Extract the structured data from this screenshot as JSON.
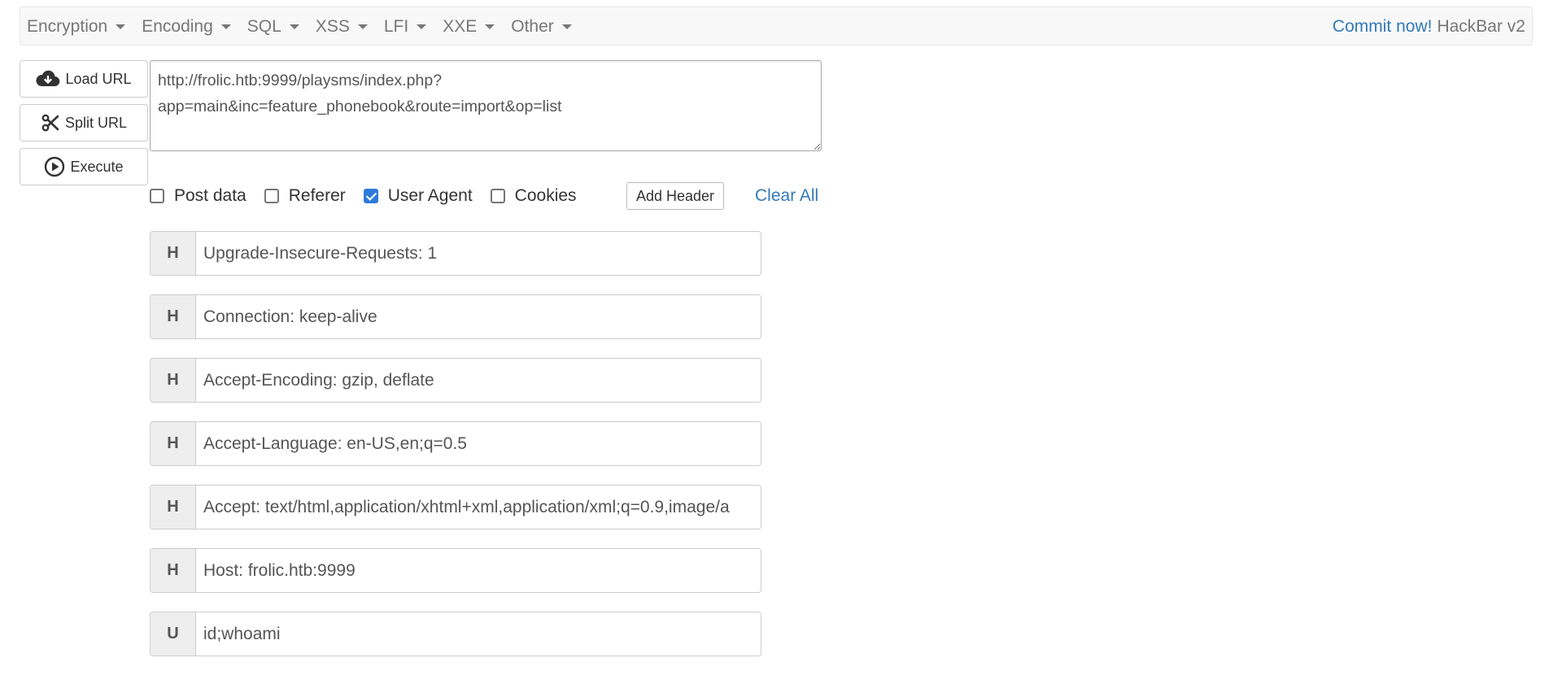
{
  "navbar": {
    "menus": [
      "Encryption",
      "Encoding",
      "SQL",
      "XSS",
      "LFI",
      "XXE",
      "Other"
    ],
    "commit_label": "Commit now!",
    "brand_title": "HackBar v2"
  },
  "side_buttons": {
    "load_url": "Load URL",
    "split_url": "Split URL",
    "execute": "Execute"
  },
  "url": {
    "value": "http://frolic.htb:9999/playsms/index.php?app=main&inc=feature_phonebook&route=import&op=list"
  },
  "options": {
    "post_data": {
      "label": "Post data",
      "checked": false
    },
    "referer": {
      "label": "Referer",
      "checked": false
    },
    "user_agent": {
      "label": "User Agent",
      "checked": true
    },
    "cookies": {
      "label": "Cookies",
      "checked": false
    },
    "add_header_label": "Add Header",
    "clear_all_label": "Clear All"
  },
  "headers": [
    {
      "tag": "H",
      "value": "Upgrade-Insecure-Requests: 1"
    },
    {
      "tag": "H",
      "value": "Connection: keep-alive"
    },
    {
      "tag": "H",
      "value": "Accept-Encoding: gzip, deflate"
    },
    {
      "tag": "H",
      "value": "Accept-Language: en-US,en;q=0.5"
    },
    {
      "tag": "H",
      "value": "Accept: text/html,application/xhtml+xml,application/xml;q=0.9,image/a"
    },
    {
      "tag": "H",
      "value": "Host: frolic.htb:9999"
    },
    {
      "tag": "U",
      "value": "id;whoami"
    }
  ],
  "colors": {
    "link": "#337ab7",
    "checkbox_checked": "#2f7bd9"
  }
}
